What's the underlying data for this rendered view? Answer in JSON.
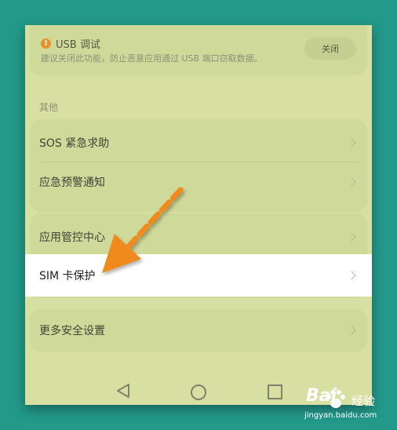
{
  "usb": {
    "title": "USB 调试",
    "description": "建议关闭此功能，防止恶意应用通过 USB 端口窃取数据。",
    "button_label": "关闭"
  },
  "section_label": "其他",
  "items": [
    {
      "label": "SOS 紧急求助"
    },
    {
      "label": "应急预警通知"
    },
    {
      "label": "应用管控中心"
    },
    {
      "label": "SIM 卡保护"
    },
    {
      "label": "更多安全设置"
    }
  ],
  "watermark": {
    "brand": "Bai",
    "name": "经验",
    "url": "jingyan.baidu.com"
  },
  "colors": {
    "background": "#23998a",
    "screen": "#d7dfa3",
    "highlight": "#ffffff",
    "arrow": "#f08a1c",
    "warning": "#e8922d"
  },
  "icons": [
    "warning-icon",
    "chevron-right-icon",
    "back-icon",
    "home-icon",
    "recent-apps-icon",
    "arrow-annotation-icon"
  ]
}
